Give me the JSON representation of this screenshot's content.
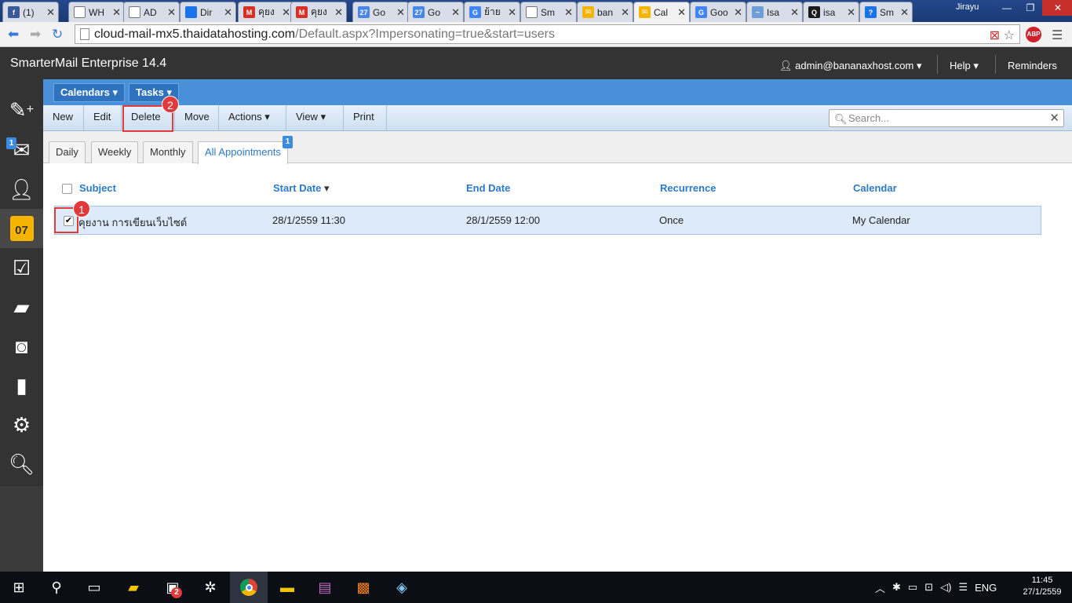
{
  "browser": {
    "tabs": [
      {
        "title": "(1)",
        "icon": "facebook-icon",
        "color": "#3b5998",
        "glyph": "f"
      },
      {
        "title": "WH",
        "icon": "page-icon",
        "color": "#ffffff",
        "glyph": ""
      },
      {
        "title": "AD",
        "icon": "page-icon",
        "color": "#ffffff",
        "glyph": ""
      },
      {
        "title": "Dir",
        "icon": "globe-icon",
        "color": "#1a73e8",
        "glyph": ""
      },
      {
        "title": "คุยง",
        "icon": "gmail-icon",
        "color": "#d93025",
        "glyph": "M"
      },
      {
        "title": "คุยง",
        "icon": "gmail-icon",
        "color": "#d93025",
        "glyph": "M"
      },
      {
        "title": "Go",
        "icon": "calendar-icon",
        "color": "#4a86e8",
        "glyph": "27"
      },
      {
        "title": "Go",
        "icon": "calendar-icon",
        "color": "#4a86e8",
        "glyph": "27"
      },
      {
        "title": "ย้าย",
        "icon": "google-icon",
        "color": "#4285f4",
        "glyph": "G"
      },
      {
        "title": "Sm",
        "icon": "page-icon",
        "color": "#ffffff",
        "glyph": ""
      },
      {
        "title": "ban",
        "icon": "envelope-icon",
        "color": "#f5b400",
        "glyph": "✉"
      },
      {
        "title": "Cal",
        "icon": "envelope-icon",
        "color": "#f5b400",
        "glyph": "✉",
        "active": true
      },
      {
        "title": "Goo",
        "icon": "google-translate-icon",
        "color": "#4285f4",
        "glyph": "G"
      },
      {
        "title": "Isa",
        "icon": "bar-icon",
        "color": "#6d9ed8",
        "glyph": "~"
      },
      {
        "title": "isa",
        "icon": "quora-icon",
        "color": "#1b1b1b",
        "glyph": "Q"
      },
      {
        "title": "Sm",
        "icon": "help-icon",
        "color": "#1a73e8",
        "glyph": "?"
      }
    ],
    "window_user": "Jirayu",
    "url_host": "cloud-mail-mx5.thaidatahosting.com",
    "url_rest": "/Default.aspx?Impersonating=true&start=users",
    "abp": "ABP"
  },
  "app": {
    "brand": "SmarterMail Enterprise 14.4",
    "user": "admin@bananaxhost.com",
    "help": "Help",
    "reminders": "Reminders",
    "mail_badge": "1",
    "calendar_day": "07"
  },
  "modules": {
    "calendars": "Calendars",
    "tasks": "Tasks"
  },
  "actions": {
    "new": "New",
    "edit": "Edit",
    "delete": "Delete",
    "move": "Move",
    "actions": "Actions",
    "view": "View",
    "print": "Print",
    "search_placeholder": "Search..."
  },
  "view_tabs": {
    "daily": "Daily",
    "weekly": "Weekly",
    "monthly": "Monthly",
    "all": "All Appointments",
    "all_badge": "1"
  },
  "grid": {
    "headers": {
      "subject": "Subject",
      "start": "Start Date",
      "end": "End Date",
      "recurrence": "Recurrence",
      "calendar": "Calendar"
    },
    "rows": [
      {
        "checked": true,
        "subject": "คุยงาน การเขียนเว็บไซต์",
        "start": "28/1/2559 11:30",
        "end": "28/1/2559 12:00",
        "recurrence": "Once",
        "calendar": "My Calendar"
      }
    ]
  },
  "annotations": {
    "step1": "1",
    "step2": "2"
  },
  "taskbar": {
    "app_badge": "2",
    "lang": "ENG",
    "time": "11:45",
    "date": "27/1/2559"
  }
}
